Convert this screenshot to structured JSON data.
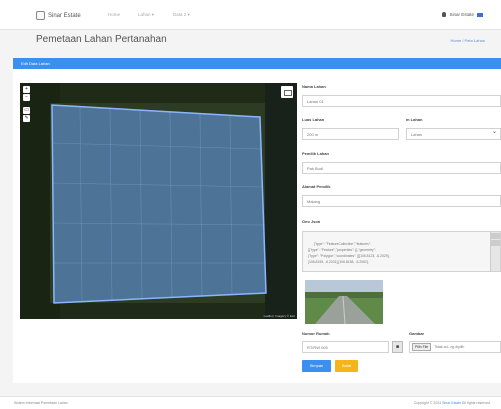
{
  "nav": {
    "brand": "Sinar Estate",
    "links": [
      "Home",
      "Lahan ▾",
      "Data 2 ▾"
    ],
    "user": "Sinar Estate"
  },
  "header": {
    "title": "Pemetaan Lahan Pertanahan",
    "breadcrumb": "Home / Peta Lahan"
  },
  "panel": {
    "title": "Edit Data Lahan"
  },
  "map": {
    "zoom_in": "+",
    "zoom_out": "−",
    "attribution": "Leaflet | Imagery © Esri",
    "satellite_color": "#1f2a17",
    "polygon_color": "#6aa2f5"
  },
  "form": {
    "nama_label": "Nama Lahan",
    "nama_value": "Lahan 01",
    "luas_label": "Luas Lahan",
    "luas_value": "200 m",
    "unit_label": "m Lahan",
    "unit_value": "Lahan",
    "pemilik_label": "Pemilik Lahan",
    "pemilik_value": "Pak Budi",
    "alamat_label": "Alamat Pemilik",
    "alamat_value": "Malang",
    "geo_label": "Geo Json",
    "geo_text": "{\"type\": \"FeatureCollection\",\"features\":\n[{\"type\": \"Feature\",\"properties\": {},\"geometry\":\n{\"type\": \"Polygon\",\"coordinates\": [[[106.8123, -6.2029],\n[106.8155, -6.2031],[106.8158, -6.2062],",
    "nomor_label": "Nomor Rumah",
    "nomor_value": "RT/RW 005",
    "gambar_label": "Gambar",
    "file_button": "Pilih File",
    "file_text": "Tidak ad...ng dipilih",
    "save_button": "Simpan",
    "back_button": "Batal"
  },
  "footer": {
    "left": "Sistem Informasi Pemetaan Lahan",
    "right": "Copyright © 2024",
    "right_link": "Sinar Estate",
    "right_tail": "All rights reserved."
  }
}
